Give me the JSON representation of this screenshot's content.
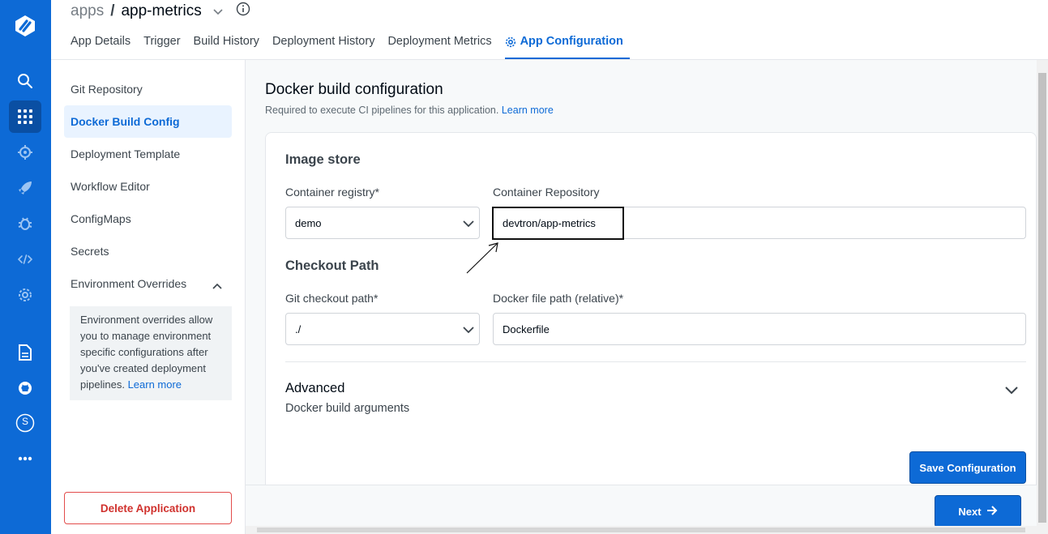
{
  "header": {
    "prefix": "apps",
    "separator": "/",
    "app_name": "app-metrics",
    "tabs": [
      {
        "label": "App Details"
      },
      {
        "label": "Trigger"
      },
      {
        "label": "Build History"
      },
      {
        "label": "Deployment History"
      },
      {
        "label": "Deployment Metrics"
      },
      {
        "label": "App Configuration",
        "active": true
      }
    ]
  },
  "rail": {
    "icons": [
      "devtron-logo-icon",
      "search-icon",
      "apps-grid-icon",
      "chart-store-icon",
      "deploy-rocket-icon",
      "security-bug-icon",
      "code-icon",
      "global-settings-icon",
      "docs-icon",
      "github-icon",
      "user-avatar-icon",
      "more-dots-icon"
    ],
    "avatar_letter": "S"
  },
  "sidebar": {
    "items": [
      {
        "label": "Git Repository"
      },
      {
        "label": "Docker Build Config",
        "active": true
      },
      {
        "label": "Deployment Template"
      },
      {
        "label": "Workflow Editor"
      },
      {
        "label": "ConfigMaps"
      },
      {
        "label": "Secrets"
      },
      {
        "label": "Environment Overrides"
      }
    ],
    "override_note": "Environment overrides allow you to manage environment specific configurations after you've created deployment pipelines.",
    "override_link": "Learn more",
    "delete_label": "Delete Application"
  },
  "main": {
    "title": "Docker build configuration",
    "subtitle": "Required to execute CI pipelines for this application.",
    "subtitle_link": "Learn more",
    "image_store": {
      "title": "Image store",
      "registry_label": "Container registry*",
      "registry_value": "demo",
      "repo_label": "Container Repository",
      "repo_value": "devtron/app-metrics"
    },
    "checkout": {
      "title": "Checkout Path",
      "git_label": "Git checkout path*",
      "git_value": "./",
      "docker_label": "Docker file path (relative)*",
      "docker_value": "Dockerfile"
    },
    "advanced": {
      "title": "Advanced",
      "subtitle": "Docker build arguments"
    },
    "save_label": "Save Configuration",
    "next_label": "Next"
  },
  "colors": {
    "brand": "#0d6ad6",
    "danger": "#d0312d"
  }
}
